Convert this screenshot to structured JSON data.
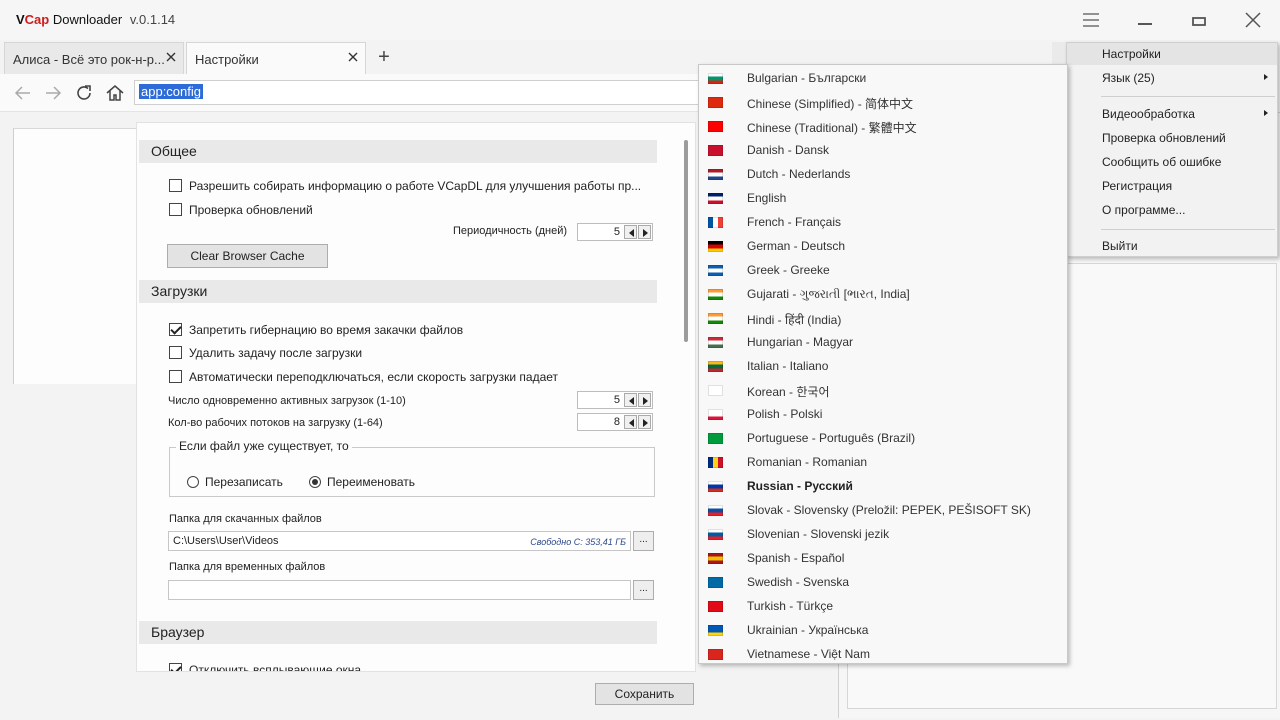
{
  "app": {
    "brand_part1": "V",
    "brand_part2": "Cap",
    "brand_part3": " Downloader",
    "version": "v.0.1.14"
  },
  "window_controls": {
    "menu_icon": "hamburger-icon",
    "minimize_icon": "minimize-icon",
    "maximize_icon": "maximize-icon",
    "close_icon": "close-icon"
  },
  "tabs": [
    {
      "label": "Алиса - Всё это рок-н-р...",
      "active": false
    },
    {
      "label": "Настройки",
      "active": true
    }
  ],
  "toolbar": {
    "url": "app:config"
  },
  "settings": {
    "general": {
      "title": "Общее",
      "collect_info": "Разрешить собирать информацию о работе VCapDL для улучшения работы пр...",
      "check_updates": "Проверка обновлений",
      "period_label": "Периодичность (дней)",
      "period_value": "5",
      "clear_cache": "Clear Browser Cache"
    },
    "downloads": {
      "title": "Загрузки",
      "no_hibernate": "Запретить гибернацию во время закачки файлов",
      "remove_task": "Удалить задачу после загрузки",
      "auto_reconnect": "Автоматически переподключаться, если скорость загрузки падает",
      "active_label": "Число одновременно активных загрузок (1-10)",
      "active_value": "5",
      "threads_label": "Кол-во рабочих потоков на загрузку (1-64)",
      "threads_value": "8",
      "exists_label": "Если файл уже существует, то",
      "overwrite": "Перезаписать",
      "rename": "Переименовать",
      "download_folder_label": "Папка для скачанных файлов",
      "download_folder": "C:\\Users\\User\\Videos",
      "free_space": "Свободно C: 353,41 ГБ",
      "temp_folder_label": "Папка для временных файлов",
      "temp_folder": "",
      "browse": "..."
    },
    "browser": {
      "title": "Браузер",
      "disable_popups": "Отключить всплывающие окна"
    },
    "save": "Сохранить"
  },
  "menu": {
    "items": [
      {
        "label": "Настройки"
      },
      {
        "label": "Язык (25)"
      },
      {
        "label": "Видеообработка"
      },
      {
        "label": "Проверка обновлений"
      },
      {
        "label": "Сообщить об ошибке"
      },
      {
        "label": "Регистрация"
      },
      {
        "label": "О программе..."
      },
      {
        "label": "Выйти"
      }
    ]
  },
  "languages": [
    {
      "label": "Bulgarian - Български",
      "flag": "bulgaria-flag",
      "colors": [
        "#ffffff",
        "#00966e",
        "#d62612"
      ],
      "orient": "h"
    },
    {
      "label": "Chinese (Simplified) - 简体中文",
      "flag": "china-flag",
      "colors": [
        "#de2910",
        "#de2910",
        "#de2910"
      ],
      "orient": "h"
    },
    {
      "label": "Chinese (Traditional) - 繁體中文",
      "flag": "taiwan-flag",
      "colors": [
        "#fe0000",
        "#fe0000",
        "#fe0000"
      ],
      "orient": "h"
    },
    {
      "label": "Danish - Dansk",
      "flag": "denmark-flag",
      "colors": [
        "#c8102e",
        "#c8102e",
        "#c8102e"
      ],
      "orient": "h"
    },
    {
      "label": "Dutch - Nederlands",
      "flag": "netherlands-flag",
      "colors": [
        "#ae1c28",
        "#ffffff",
        "#21468b"
      ],
      "orient": "h"
    },
    {
      "label": "English",
      "flag": "uk-flag",
      "colors": [
        "#012169",
        "#ffffff",
        "#c8102e"
      ],
      "orient": "h"
    },
    {
      "label": "French - Français",
      "flag": "france-flag",
      "colors": [
        "#0055a4",
        "#ffffff",
        "#ef4135"
      ],
      "orient": "v"
    },
    {
      "label": "German - Deutsch",
      "flag": "germany-flag",
      "colors": [
        "#000000",
        "#dd0000",
        "#ffce00"
      ],
      "orient": "h"
    },
    {
      "label": "Greek - Greeke",
      "flag": "greece-flag",
      "colors": [
        "#0d5eaf",
        "#ffffff",
        "#0d5eaf"
      ],
      "orient": "h"
    },
    {
      "label": "Gujarati - ગુજરાતી [ભારત, India]",
      "flag": "india-flag",
      "colors": [
        "#ff9933",
        "#ffffff",
        "#138808"
      ],
      "orient": "h"
    },
    {
      "label": "Hindi - हिंदी (India)",
      "flag": "india-flag",
      "colors": [
        "#ff9933",
        "#ffffff",
        "#138808"
      ],
      "orient": "h"
    },
    {
      "label": "Hungarian - Magyar",
      "flag": "hungary-flag",
      "colors": [
        "#ce2939",
        "#ffffff",
        "#477050"
      ],
      "orient": "h"
    },
    {
      "label": "Italian - Italiano",
      "flag": "lithuania-flag",
      "colors": [
        "#fdb913",
        "#006a44",
        "#c1272d"
      ],
      "orient": "h"
    },
    {
      "label": "Korean - 한국어",
      "flag": "korea-flag",
      "colors": [
        "#ffffff",
        "#ffffff",
        "#ffffff"
      ],
      "orient": "h"
    },
    {
      "label": "Polish - Polski",
      "flag": "poland-flag",
      "colors": [
        "#ffffff",
        "#ffffff",
        "#dc143c"
      ],
      "orient": "h"
    },
    {
      "label": "Portuguese - Português (Brazil)",
      "flag": "brazil-flag",
      "colors": [
        "#009c3b",
        "#009c3b",
        "#009c3b"
      ],
      "orient": "h"
    },
    {
      "label": "Romanian - Romanian",
      "flag": "romania-flag",
      "colors": [
        "#002b7f",
        "#fcd116",
        "#ce1126"
      ],
      "orient": "v"
    },
    {
      "label": "Russian - Русский",
      "flag": "russia-flag",
      "colors": [
        "#ffffff",
        "#0039a6",
        "#d52b1e"
      ],
      "orient": "h",
      "selected": true
    },
    {
      "label": "Slovak - Slovensky (Preložil: PEPEK, PEŠISOFT SK)",
      "flag": "slovakia-flag",
      "colors": [
        "#ffffff",
        "#0b4ea2",
        "#ee1c25"
      ],
      "orient": "h"
    },
    {
      "label": "Slovenian - Slovenski jezik",
      "flag": "slovenia-flag",
      "colors": [
        "#ffffff",
        "#005da4",
        "#ed1c24"
      ],
      "orient": "h"
    },
    {
      "label": "Spanish - Español",
      "flag": "spain-flag",
      "colors": [
        "#aa151b",
        "#f1bf00",
        "#aa151b"
      ],
      "orient": "h"
    },
    {
      "label": "Swedish - Svenska",
      "flag": "sweden-flag",
      "colors": [
        "#006aa7",
        "#006aa7",
        "#006aa7"
      ],
      "orient": "h"
    },
    {
      "label": "Turkish - Türkçe",
      "flag": "turkey-flag",
      "colors": [
        "#e30a17",
        "#e30a17",
        "#e30a17"
      ],
      "orient": "h"
    },
    {
      "label": "Ukrainian - Українська",
      "flag": "ukraine-flag",
      "colors": [
        "#0057b7",
        "#0057b7",
        "#ffd700"
      ],
      "orient": "h"
    },
    {
      "label": "Vietnamese - Việt Nam",
      "flag": "vietnam-flag",
      "colors": [
        "#da251d",
        "#da251d",
        "#da251d"
      ],
      "orient": "h"
    }
  ]
}
